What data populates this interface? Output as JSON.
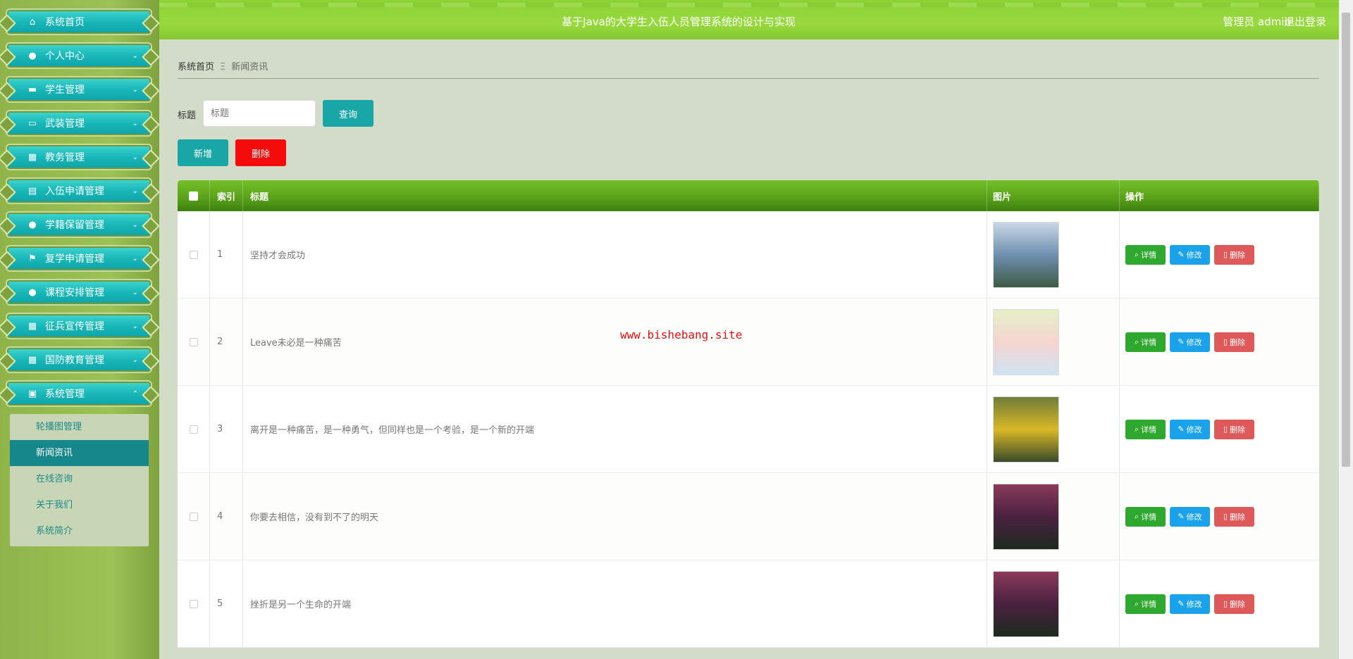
{
  "header": {
    "title": "基于Java的大学生入伍人员管理系统的设计与实现",
    "user": "管理员 admin",
    "logout": "退出登录"
  },
  "sidebar": {
    "items": [
      {
        "label": "系统首页",
        "icon": "home-icon",
        "glyph": "⌂",
        "chevron": ""
      },
      {
        "label": "个人中心",
        "icon": "user-icon",
        "glyph": "●",
        "chevron": "⌄"
      },
      {
        "label": "学生管理",
        "icon": "chat-icon",
        "glyph": "▬",
        "chevron": "⌄"
      },
      {
        "label": "武装管理",
        "icon": "monitor-icon",
        "glyph": "▭",
        "chevron": "⌄"
      },
      {
        "label": "教务管理",
        "icon": "grid-icon",
        "glyph": "▦",
        "chevron": "⌄"
      },
      {
        "label": "入伍申请管理",
        "icon": "clipboard-icon",
        "glyph": "▤",
        "chevron": "⌄"
      },
      {
        "label": "学籍保留管理",
        "icon": "user-icon",
        "glyph": "●",
        "chevron": "⌄"
      },
      {
        "label": "复学申请管理",
        "icon": "flag-icon",
        "glyph": "⚑",
        "chevron": "⌄"
      },
      {
        "label": "课程安排管理",
        "icon": "person-icon",
        "glyph": "●",
        "chevron": "⌄"
      },
      {
        "label": "征兵宣传管理",
        "icon": "grid-icon",
        "glyph": "▦",
        "chevron": "⌄"
      },
      {
        "label": "国防教育管理",
        "icon": "grid-icon",
        "glyph": "▦",
        "chevron": "⌄"
      },
      {
        "label": "系统管理",
        "icon": "briefcase-icon",
        "glyph": "▣",
        "chevron": "⌃"
      }
    ],
    "submenu": [
      "轮播图管理",
      "新闻资讯",
      "在线咨询",
      "关于我们",
      "系统简介"
    ]
  },
  "breadcrumb": {
    "home": "系统首页",
    "sep": "Ξ",
    "current": "新闻资讯"
  },
  "search": {
    "label": "标题",
    "placeholder": "标题",
    "button": "查询"
  },
  "actions": {
    "add": "新增",
    "delete": "删除"
  },
  "table": {
    "headers": {
      "index": "索引",
      "title": "标题",
      "image": "图片",
      "ops": "操作"
    },
    "rows": [
      {
        "index": "1",
        "title": "坚持才会成功",
        "thumb_colors": [
          "#6f8fb0",
          "#c9d8e6",
          "#3e5a45"
        ]
      },
      {
        "index": "2",
        "title": "Leave未必是一种痛苦",
        "thumb_colors": [
          "#f5d5d0",
          "#e6f0c8",
          "#cfe3f2"
        ]
      },
      {
        "index": "3",
        "title": "离开是一种痛苦，是一种勇气，但同样也是一个考验，是一个新的开端",
        "thumb_colors": [
          "#d9b826",
          "#6f7c3a",
          "#3a4a2a"
        ]
      },
      {
        "index": "4",
        "title": "你要去相信，没有到不了的明天",
        "thumb_colors": [
          "#4a2140",
          "#8a3a5a",
          "#1d2a1d"
        ]
      },
      {
        "index": "5",
        "title": "挫折是另一个生命的开端",
        "thumb_colors": [
          "#4a2140",
          "#8a3a5a",
          "#1d2a1d"
        ]
      }
    ],
    "op_labels": {
      "detail": "详情",
      "edit": "修改",
      "delete": "删除"
    }
  },
  "watermark": "www.bishebang.site"
}
